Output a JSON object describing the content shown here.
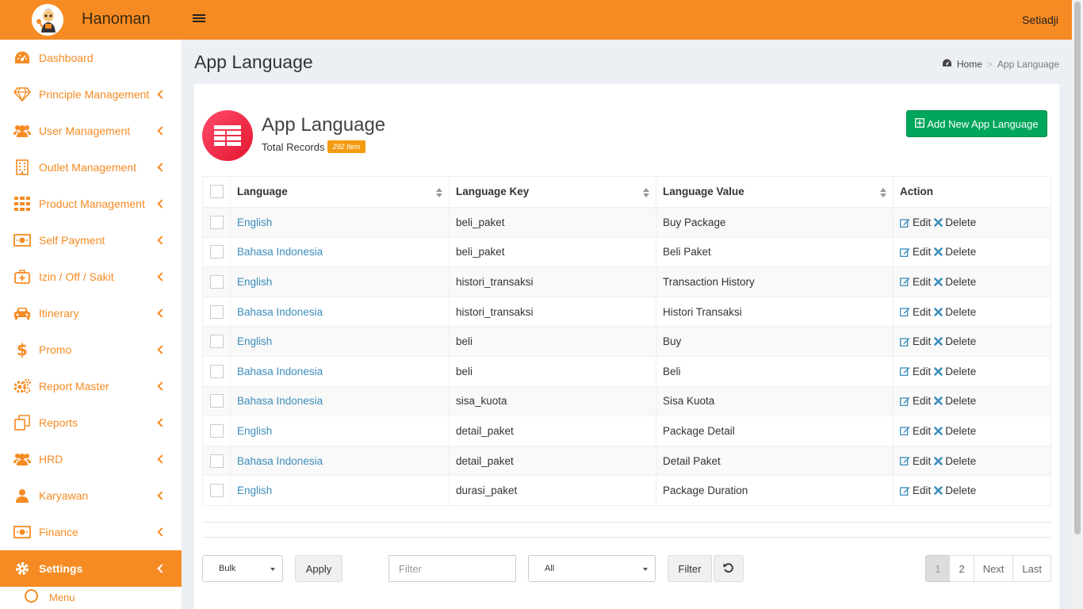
{
  "header": {
    "brand": "Hanoman",
    "user": "Setiadji"
  },
  "sidebar": {
    "items": [
      {
        "label": "Dashboard",
        "icon": "dashboard-icon",
        "chevron": false
      },
      {
        "label": "Principle Management",
        "icon": "diamond-icon",
        "chevron": true
      },
      {
        "label": "User Management",
        "icon": "users-icon",
        "chevron": true
      },
      {
        "label": "Outlet Management",
        "icon": "building-icon",
        "chevron": true
      },
      {
        "label": "Product Management",
        "icon": "grid-icon",
        "chevron": true
      },
      {
        "label": "Self Payment",
        "icon": "money-icon",
        "chevron": true
      },
      {
        "label": "Izin / Off / Sakit",
        "icon": "medkit-icon",
        "chevron": true
      },
      {
        "label": "Itinerary",
        "icon": "car-icon",
        "chevron": true
      },
      {
        "label": "Promo",
        "icon": "dollar-icon",
        "chevron": true
      },
      {
        "label": "Report Master",
        "icon": "gears-icon",
        "chevron": true
      },
      {
        "label": "Reports",
        "icon": "clone-icon",
        "chevron": true
      },
      {
        "label": "HRD",
        "icon": "users-icon",
        "chevron": true
      },
      {
        "label": "Karyawan",
        "icon": "user-icon",
        "chevron": true
      },
      {
        "label": "Finance",
        "icon": "money-icon",
        "chevron": true
      },
      {
        "label": "Settings",
        "icon": "gear-icon",
        "chevron": true
      }
    ],
    "sub_item": "Menu"
  },
  "page": {
    "title": "App Language",
    "breadcrumb": {
      "home": "Home",
      "current": "App Language"
    }
  },
  "box": {
    "title": "App Language",
    "total_label": "Total Records",
    "total_badge": "292 Item",
    "add_button": "Add New App Language"
  },
  "table": {
    "headers": {
      "language": "Language",
      "key": "Language Key",
      "value": "Language Value",
      "action": "Action"
    },
    "edit_label": "Edit",
    "delete_label": "Delete",
    "rows": [
      {
        "language": "English",
        "key": "beli_paket",
        "value": "Buy Package"
      },
      {
        "language": "Bahasa Indonesia",
        "key": "beli_paket",
        "value": "Beli Paket"
      },
      {
        "language": "English",
        "key": "histori_transaksi",
        "value": "Transaction History"
      },
      {
        "language": "Bahasa Indonesia",
        "key": "histori_transaksi",
        "value": "Histori Transaksi"
      },
      {
        "language": "English",
        "key": "beli",
        "value": "Buy"
      },
      {
        "language": "Bahasa Indonesia",
        "key": "beli",
        "value": "Beli"
      },
      {
        "language": "Bahasa Indonesia",
        "key": "sisa_kuota",
        "value": "Sisa Kuota"
      },
      {
        "language": "English",
        "key": "detail_paket",
        "value": "Package Detail"
      },
      {
        "language": "Bahasa Indonesia",
        "key": "detail_paket",
        "value": "Detail Paket"
      },
      {
        "language": "English",
        "key": "durasi_paket",
        "value": "Package Duration"
      }
    ]
  },
  "controls": {
    "bulk": "Bulk",
    "apply": "Apply",
    "filter_placeholder": "Filter",
    "all": "All",
    "filter_button": "Filter"
  },
  "pagination": {
    "pages": [
      "1",
      "2"
    ],
    "next": "Next",
    "last": "Last",
    "active": "1"
  },
  "colors": {
    "brand": "#f68b23",
    "success": "#00a65a",
    "link": "#3c8dbc",
    "badge": "#f39c12"
  }
}
